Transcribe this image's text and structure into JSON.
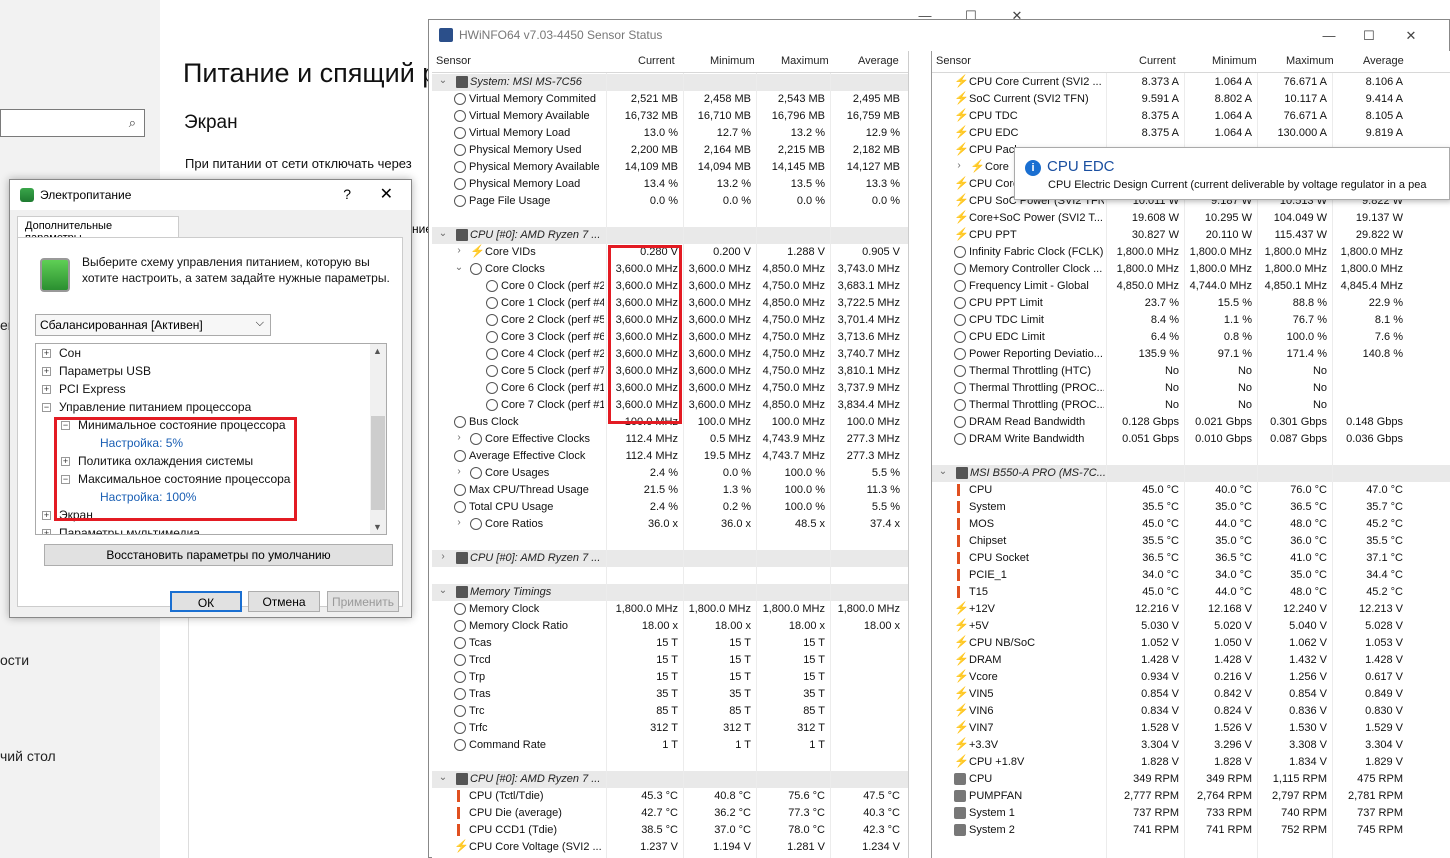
{
  "background_window": {
    "title": "Питание и спящий р",
    "subtitle": "Экран",
    "line": "При питании от сети отключать через",
    "side_labels": [
      "ей",
      "ости",
      "чий стол"
    ],
    "fragment": "ние"
  },
  "hwinfo": {
    "title": "HWiNFO64 v7.03-4450 Sensor Status",
    "columns": [
      "Sensor",
      "Current",
      "Minimum",
      "Maximum",
      "Average"
    ],
    "left_rows": [
      {
        "t": "grp",
        "label": "System: MSI MS-7C56",
        "exp": "v"
      },
      {
        "t": "clock",
        "label": "Virtual Memory Commited",
        "v": [
          "2,521 MB",
          "2,458 MB",
          "2,543 MB",
          "2,495 MB"
        ]
      },
      {
        "t": "clock",
        "label": "Virtual Memory Available",
        "v": [
          "16,732 MB",
          "16,710 MB",
          "16,796 MB",
          "16,759 MB"
        ]
      },
      {
        "t": "clock",
        "label": "Virtual Memory Load",
        "v": [
          "13.0 %",
          "12.7 %",
          "13.2 %",
          "12.9 %"
        ]
      },
      {
        "t": "clock",
        "label": "Physical Memory Used",
        "v": [
          "2,200 MB",
          "2,164 MB",
          "2,215 MB",
          "2,182 MB"
        ]
      },
      {
        "t": "clock",
        "label": "Physical Memory Available",
        "v": [
          "14,109 MB",
          "14,094 MB",
          "14,145 MB",
          "14,127 MB"
        ]
      },
      {
        "t": "clock",
        "label": "Physical Memory Load",
        "v": [
          "13.4 %",
          "13.2 %",
          "13.5 %",
          "13.3 %"
        ]
      },
      {
        "t": "clock",
        "label": "Page File Usage",
        "v": [
          "0.0 %",
          "0.0 %",
          "0.0 %",
          "0.0 %"
        ]
      },
      {
        "t": "blank"
      },
      {
        "t": "grp",
        "label": "CPU [#0]: AMD Ryzen 7 ...",
        "exp": "v"
      },
      {
        "t": "bolt",
        "label": "Core VIDs",
        "exp": ">",
        "ind": 1,
        "v": [
          "0.280 V",
          "0.200 V",
          "1.288 V",
          "0.905 V"
        ]
      },
      {
        "t": "clock",
        "label": "Core Clocks",
        "exp": "v",
        "ind": 1,
        "v": [
          "3,600.0 MHz",
          "3,600.0 MHz",
          "4,850.0 MHz",
          "3,743.0 MHz"
        ]
      },
      {
        "t": "clock",
        "label": "Core 0 Clock (perf #2...",
        "ind": 2,
        "v": [
          "3,600.0 MHz",
          "3,600.0 MHz",
          "4,750.0 MHz",
          "3,683.1 MHz"
        ]
      },
      {
        "t": "clock",
        "label": "Core 1 Clock (perf #4...",
        "ind": 2,
        "v": [
          "3,600.0 MHz",
          "3,600.0 MHz",
          "4,850.0 MHz",
          "3,722.5 MHz"
        ]
      },
      {
        "t": "clock",
        "label": "Core 2 Clock (perf #5...",
        "ind": 2,
        "v": [
          "3,600.0 MHz",
          "3,600.0 MHz",
          "4,750.0 MHz",
          "3,701.4 MHz"
        ]
      },
      {
        "t": "clock",
        "label": "Core 3 Clock (perf #6...",
        "ind": 2,
        "v": [
          "3,600.0 MHz",
          "3,600.0 MHz",
          "4,750.0 MHz",
          "3,713.6 MHz"
        ]
      },
      {
        "t": "clock",
        "label": "Core 4 Clock (perf #2...",
        "ind": 2,
        "v": [
          "3,600.0 MHz",
          "3,600.0 MHz",
          "4,750.0 MHz",
          "3,740.7 MHz"
        ]
      },
      {
        "t": "clock",
        "label": "Core 5 Clock (perf #7...",
        "ind": 2,
        "v": [
          "3,600.0 MHz",
          "3,600.0 MHz",
          "4,750.0 MHz",
          "3,810.1 MHz"
        ]
      },
      {
        "t": "clock",
        "label": "Core 6 Clock (perf #1...",
        "ind": 2,
        "v": [
          "3,600.0 MHz",
          "3,600.0 MHz",
          "4,750.0 MHz",
          "3,737.9 MHz"
        ]
      },
      {
        "t": "clock",
        "label": "Core 7 Clock (perf #1...",
        "ind": 2,
        "v": [
          "3,600.0 MHz",
          "3,600.0 MHz",
          "4,850.0 MHz",
          "3,834.4 MHz"
        ]
      },
      {
        "t": "clock",
        "label": "Bus Clock",
        "v": [
          "100.0 MHz",
          "100.0 MHz",
          "100.0 MHz",
          "100.0 MHz"
        ]
      },
      {
        "t": "clock",
        "label": "Core Effective Clocks",
        "exp": ">",
        "ind": 1,
        "v": [
          "112.4 MHz",
          "0.5 MHz",
          "4,743.9 MHz",
          "277.3 MHz"
        ]
      },
      {
        "t": "clock",
        "label": "Average Effective Clock",
        "v": [
          "112.4 MHz",
          "19.5 MHz",
          "4,743.7 MHz",
          "277.3 MHz"
        ]
      },
      {
        "t": "clock",
        "label": "Core Usages",
        "exp": ">",
        "ind": 1,
        "v": [
          "2.4 %",
          "0.0 %",
          "100.0 %",
          "5.5 %"
        ]
      },
      {
        "t": "clock",
        "label": "Max CPU/Thread Usage",
        "v": [
          "21.5 %",
          "1.3 %",
          "100.0 %",
          "11.3 %"
        ]
      },
      {
        "t": "clock",
        "label": "Total CPU Usage",
        "v": [
          "2.4 %",
          "0.2 %",
          "100.0 %",
          "5.5 %"
        ]
      },
      {
        "t": "clock",
        "label": "Core Ratios",
        "exp": ">",
        "ind": 1,
        "v": [
          "36.0 x",
          "36.0 x",
          "48.5 x",
          "37.4 x"
        ]
      },
      {
        "t": "blank"
      },
      {
        "t": "grp",
        "label": "CPU [#0]: AMD Ryzen 7 ...",
        "exp": ">"
      },
      {
        "t": "blank"
      },
      {
        "t": "grp",
        "label": "Memory Timings",
        "exp": "v"
      },
      {
        "t": "clock",
        "label": "Memory Clock",
        "v": [
          "1,800.0 MHz",
          "1,800.0 MHz",
          "1,800.0 MHz",
          "1,800.0 MHz"
        ]
      },
      {
        "t": "clock",
        "label": "Memory Clock Ratio",
        "v": [
          "18.00 x",
          "18.00 x",
          "18.00 x",
          "18.00 x"
        ]
      },
      {
        "t": "clock",
        "label": "Tcas",
        "v": [
          "15 T",
          "15 T",
          "15 T",
          ""
        ]
      },
      {
        "t": "clock",
        "label": "Trcd",
        "v": [
          "15 T",
          "15 T",
          "15 T",
          ""
        ]
      },
      {
        "t": "clock",
        "label": "Trp",
        "v": [
          "15 T",
          "15 T",
          "15 T",
          ""
        ]
      },
      {
        "t": "clock",
        "label": "Tras",
        "v": [
          "35 T",
          "35 T",
          "35 T",
          ""
        ]
      },
      {
        "t": "clock",
        "label": "Trc",
        "v": [
          "85 T",
          "85 T",
          "85 T",
          ""
        ]
      },
      {
        "t": "clock",
        "label": "Trfc",
        "v": [
          "312 T",
          "312 T",
          "312 T",
          ""
        ]
      },
      {
        "t": "clock",
        "label": "Command Rate",
        "v": [
          "1 T",
          "1 T",
          "1 T",
          ""
        ]
      },
      {
        "t": "blank"
      },
      {
        "t": "grp",
        "label": "CPU [#0]: AMD Ryzen 7 ...",
        "exp": "v"
      },
      {
        "t": "therm",
        "label": "CPU (Tctl/Tdie)",
        "v": [
          "45.3 °C",
          "40.8 °C",
          "75.6 °C",
          "47.5 °C"
        ]
      },
      {
        "t": "therm",
        "label": "CPU Die (average)",
        "v": [
          "42.7 °C",
          "36.2 °C",
          "77.3 °C",
          "40.3 °C"
        ]
      },
      {
        "t": "therm",
        "label": "CPU CCD1 (Tdie)",
        "v": [
          "38.5 °C",
          "37.0 °C",
          "78.0 °C",
          "42.3 °C"
        ]
      },
      {
        "t": "bolt",
        "label": "CPU Core Voltage (SVI2 ...",
        "v": [
          "1.237 V",
          "1.194 V",
          "1.281 V",
          "1.234 V"
        ]
      }
    ],
    "right_rows": [
      {
        "t": "bolt",
        "label": "CPU Core Current (SVI2 ...",
        "v": [
          "8.373 A",
          "1.064 A",
          "76.671 A",
          "8.106 A"
        ]
      },
      {
        "t": "bolt",
        "label": "SoC Current (SVI2 TFN)",
        "v": [
          "9.591 A",
          "8.802 A",
          "10.117 A",
          "9.414 A"
        ]
      },
      {
        "t": "bolt",
        "label": "CPU TDC",
        "v": [
          "8.375 A",
          "1.064 A",
          "76.671 A",
          "8.105 A"
        ]
      },
      {
        "t": "bolt",
        "label": "CPU EDC",
        "v": [
          "8.375 A",
          "1.064 A",
          "130.000 A",
          "9.819 A"
        ]
      },
      {
        "t": "bolt",
        "label": "CPU Pack",
        "v": [
          "",
          "",
          "",
          ""
        ]
      },
      {
        "t": "bolt",
        "label": "Core",
        "exp": ">",
        "ind": 1,
        "v": [
          "",
          "",
          "",
          ""
        ]
      },
      {
        "t": "bolt",
        "label": "CPU Core",
        "v": [
          "",
          "",
          "",
          ""
        ]
      },
      {
        "t": "bolt",
        "label": "CPU SoC Power (SVI2 TFN)",
        "v": [
          "10.011 W",
          "9.187 W",
          "10.513 W",
          "9.822 W"
        ]
      },
      {
        "t": "bolt",
        "label": "Core+SoC Power (SVI2 T...",
        "v": [
          "19.608 W",
          "10.295 W",
          "104.049 W",
          "19.137 W"
        ]
      },
      {
        "t": "bolt",
        "label": "CPU PPT",
        "v": [
          "30.827 W",
          "20.110 W",
          "115.437 W",
          "29.822 W"
        ]
      },
      {
        "t": "clock",
        "label": "Infinity Fabric Clock (FCLK)",
        "v": [
          "1,800.0 MHz",
          "1,800.0 MHz",
          "1,800.0 MHz",
          "1,800.0 MHz"
        ]
      },
      {
        "t": "clock",
        "label": "Memory Controller Clock ...",
        "v": [
          "1,800.0 MHz",
          "1,800.0 MHz",
          "1,800.0 MHz",
          "1,800.0 MHz"
        ]
      },
      {
        "t": "clock",
        "label": "Frequency Limit - Global",
        "v": [
          "4,850.0 MHz",
          "4,744.0 MHz",
          "4,850.1 MHz",
          "4,845.4 MHz"
        ]
      },
      {
        "t": "clock",
        "label": "CPU PPT Limit",
        "v": [
          "23.7 %",
          "15.5 %",
          "88.8 %",
          "22.9 %"
        ]
      },
      {
        "t": "clock",
        "label": "CPU TDC Limit",
        "v": [
          "8.4 %",
          "1.1 %",
          "76.7 %",
          "8.1 %"
        ]
      },
      {
        "t": "clock",
        "label": "CPU EDC Limit",
        "v": [
          "6.4 %",
          "0.8 %",
          "100.0 %",
          "7.6 %"
        ]
      },
      {
        "t": "clock",
        "label": "Power Reporting Deviatio...",
        "v": [
          "135.9 %",
          "97.1 %",
          "171.4 %",
          "140.8 %"
        ]
      },
      {
        "t": "clock",
        "label": "Thermal Throttling (HTC)",
        "v": [
          "No",
          "No",
          "No",
          ""
        ]
      },
      {
        "t": "clock",
        "label": "Thermal Throttling (PROC...",
        "v": [
          "No",
          "No",
          "No",
          ""
        ]
      },
      {
        "t": "clock",
        "label": "Thermal Throttling (PROC...",
        "v": [
          "No",
          "No",
          "No",
          ""
        ]
      },
      {
        "t": "clock",
        "label": "DRAM Read Bandwidth",
        "v": [
          "0.128 Gbps",
          "0.021 Gbps",
          "0.301 Gbps",
          "0.148 Gbps"
        ]
      },
      {
        "t": "clock",
        "label": "DRAM Write Bandwidth",
        "v": [
          "0.051 Gbps",
          "0.010 Gbps",
          "0.087 Gbps",
          "0.036 Gbps"
        ]
      },
      {
        "t": "blank"
      },
      {
        "t": "grp",
        "label": "MSI B550-A PRO (MS-7C...",
        "exp": "v"
      },
      {
        "t": "therm",
        "label": "CPU",
        "v": [
          "45.0 °C",
          "40.0 °C",
          "76.0 °C",
          "47.0 °C"
        ]
      },
      {
        "t": "therm",
        "label": "System",
        "v": [
          "35.5 °C",
          "35.0 °C",
          "36.5 °C",
          "35.7 °C"
        ]
      },
      {
        "t": "therm",
        "label": "MOS",
        "v": [
          "45.0 °C",
          "44.0 °C",
          "48.0 °C",
          "45.2 °C"
        ]
      },
      {
        "t": "therm",
        "label": "Chipset",
        "v": [
          "35.5 °C",
          "35.0 °C",
          "36.0 °C",
          "35.5 °C"
        ]
      },
      {
        "t": "therm",
        "label": "CPU Socket",
        "v": [
          "36.5 °C",
          "36.5 °C",
          "41.0 °C",
          "37.1 °C"
        ]
      },
      {
        "t": "therm",
        "label": "PCIE_1",
        "v": [
          "34.0 °C",
          "34.0 °C",
          "35.0 °C",
          "34.4 °C"
        ]
      },
      {
        "t": "therm",
        "label": "T15",
        "v": [
          "45.0 °C",
          "44.0 °C",
          "48.0 °C",
          "45.2 °C"
        ]
      },
      {
        "t": "bolt",
        "label": "+12V",
        "v": [
          "12.216 V",
          "12.168 V",
          "12.240 V",
          "12.213 V"
        ]
      },
      {
        "t": "bolt",
        "label": "+5V",
        "v": [
          "5.030 V",
          "5.020 V",
          "5.040 V",
          "5.028 V"
        ]
      },
      {
        "t": "bolt",
        "label": "CPU NB/SoC",
        "v": [
          "1.052 V",
          "1.050 V",
          "1.062 V",
          "1.053 V"
        ]
      },
      {
        "t": "bolt",
        "label": "DRAM",
        "v": [
          "1.428 V",
          "1.428 V",
          "1.432 V",
          "1.428 V"
        ]
      },
      {
        "t": "bolt",
        "label": "Vcore",
        "v": [
          "0.934 V",
          "0.216 V",
          "1.256 V",
          "0.617 V"
        ]
      },
      {
        "t": "bolt",
        "label": "VIN5",
        "v": [
          "0.854 V",
          "0.842 V",
          "0.854 V",
          "0.849 V"
        ]
      },
      {
        "t": "bolt",
        "label": "VIN6",
        "v": [
          "0.834 V",
          "0.824 V",
          "0.836 V",
          "0.830 V"
        ]
      },
      {
        "t": "bolt",
        "label": "VIN7",
        "v": [
          "1.528 V",
          "1.526 V",
          "1.530 V",
          "1.529 V"
        ]
      },
      {
        "t": "bolt",
        "label": "+3.3V",
        "v": [
          "3.304 V",
          "3.296 V",
          "3.308 V",
          "3.304 V"
        ]
      },
      {
        "t": "bolt",
        "label": "CPU +1.8V",
        "v": [
          "1.828 V",
          "1.828 V",
          "1.834 V",
          "1.829 V"
        ]
      },
      {
        "t": "fan",
        "label": "CPU",
        "v": [
          "349 RPM",
          "349 RPM",
          "1,115 RPM",
          "475 RPM"
        ]
      },
      {
        "t": "fan",
        "label": "PUMPFAN",
        "v": [
          "2,777 RPM",
          "2,764 RPM",
          "2,797 RPM",
          "2,781 RPM"
        ]
      },
      {
        "t": "fan",
        "label": "System 1",
        "v": [
          "737 RPM",
          "733 RPM",
          "740 RPM",
          "737 RPM"
        ]
      },
      {
        "t": "fan",
        "label": "System 2",
        "v": [
          "741 RPM",
          "741 RPM",
          "752 RPM",
          "745 RPM"
        ]
      }
    ]
  },
  "tooltip": {
    "title": "CPU EDC",
    "text": "CPU Electric Design Current (current deliverable by voltage regulator in a pea"
  },
  "power_dialog": {
    "title": "Электропитание",
    "help": "?",
    "close": "✕",
    "tab": "Дополнительные параметры",
    "description": "Выберите схему управления питанием, которую вы хотите настроить, а затем задайте нужные параметры.",
    "scheme": "Сбалансированная [Активен]",
    "tree": [
      {
        "label": "Сон",
        "box": "+",
        "lvl": 0
      },
      {
        "label": "Параметры USB",
        "box": "+",
        "lvl": 0
      },
      {
        "label": "PCI Express",
        "box": "+",
        "lvl": 0
      },
      {
        "label": "Управление питанием процессора",
        "box": "−",
        "lvl": 0
      },
      {
        "label": "Минимальное состояние процессора",
        "box": "−",
        "lvl": 1
      },
      {
        "label": "Настройка: 5%",
        "box": "",
        "lvl": 2,
        "val": true
      },
      {
        "label": "Политика охлаждения системы",
        "box": "+",
        "lvl": 1
      },
      {
        "label": "Максимальное состояние процессора",
        "box": "−",
        "lvl": 1
      },
      {
        "label": "Настройка: 100%",
        "box": "",
        "lvl": 2,
        "val": true
      },
      {
        "label": "Экран",
        "box": "+",
        "lvl": 0
      },
      {
        "label": "Параметры мультимедиа",
        "box": "+",
        "lvl": 0
      }
    ],
    "restore": "Восстановить параметры по умолчанию",
    "ok": "ОК",
    "cancel": "Отмена",
    "apply": "Применить"
  },
  "colors": {
    "highlight_red": "#e31b23",
    "value_blue": "#1a5fb4"
  }
}
